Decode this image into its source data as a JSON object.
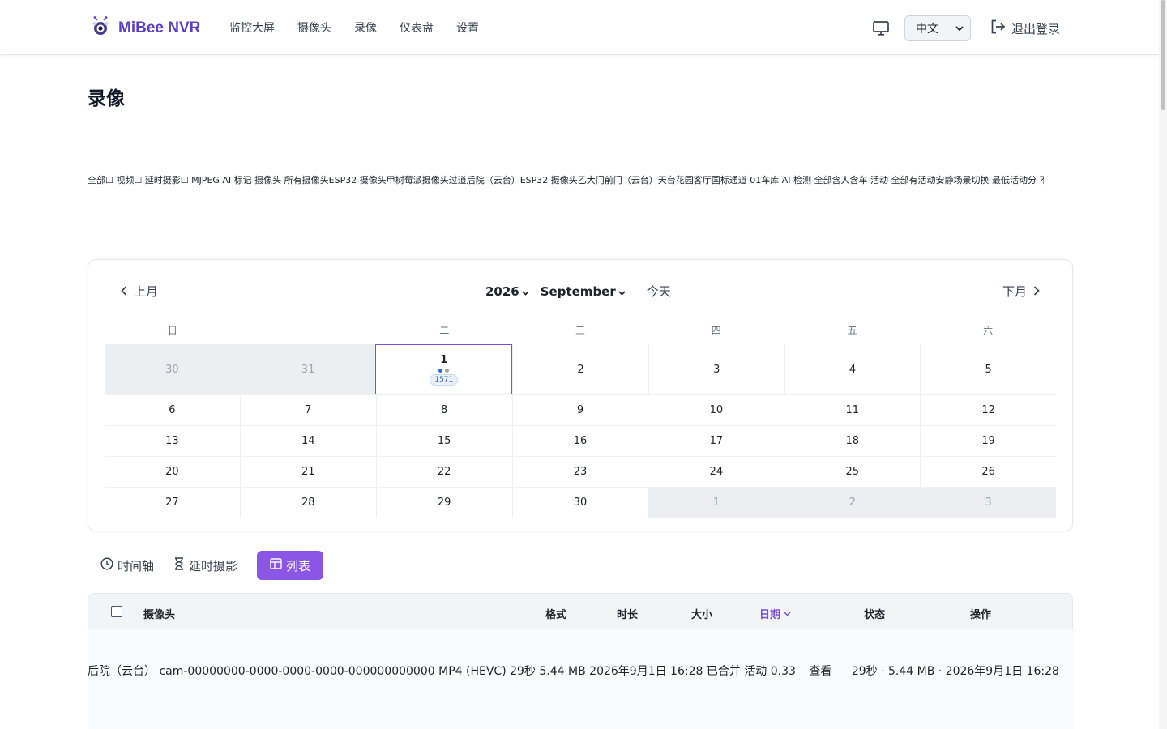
{
  "header": {
    "brand": "MiBee NVR",
    "nav": [
      "监控大屏",
      "摄像头",
      "录像",
      "仪表盘",
      "设置"
    ],
    "language": "中文",
    "logout": "退出登录"
  },
  "page": {
    "title": "录像",
    "filters_text": "全部☐ 视频☐ 延时摄影☐ MJPEG  AI 标记 摄像头 所有摄像头ESP32 摄像头甲树莓派摄像头过道后院（云台）ESP32 摄像头乙大门前门（云台）天台花园客厅国标通道 01车库 AI 检测 全部含人含车 活动 全部有活动安静场景切换 最低活动分 不"
  },
  "calendar": {
    "prev_label": "上月",
    "next_label": "下月",
    "year": "2026",
    "month": "September",
    "today_label": "今天",
    "weekdays": [
      "日",
      "一",
      "二",
      "三",
      "四",
      "五",
      "六"
    ],
    "weeks": [
      [
        "30",
        "31",
        "1",
        "2",
        "3",
        "4",
        "5"
      ],
      [
        "6",
        "7",
        "8",
        "9",
        "10",
        "11",
        "12"
      ],
      [
        "13",
        "14",
        "15",
        "16",
        "17",
        "18",
        "19"
      ],
      [
        "20",
        "21",
        "22",
        "23",
        "24",
        "25",
        "26"
      ],
      [
        "27",
        "28",
        "29",
        "30",
        "1",
        "2",
        "3"
      ]
    ],
    "selected_day_count": "1571",
    "colors": {
      "dot_primary": "#2f66c8",
      "dot_secondary": "#9ca3af",
      "accent": "#7c4ddb"
    }
  },
  "view_tabs": [
    {
      "label": "时间轴",
      "icon": "clock-icon"
    },
    {
      "label": "延时摄影",
      "icon": "hourglass-icon"
    },
    {
      "label": "列表",
      "icon": "table-icon",
      "active": true
    }
  ],
  "table": {
    "columns": {
      "camera": "摄像头",
      "format": "格式",
      "duration": "时长",
      "size": "大小",
      "date": "日期",
      "status": "状态",
      "actions": "操作"
    },
    "rows": [
      {
        "camera": "后院（云台）",
        "id": "cam-00000000-0000-0000-0000-000000000000",
        "format": "MP4 (HEVC)",
        "duration": "29秒",
        "size": "5.44 MB",
        "date": "2026年9月1日 16:28",
        "status": "已合并",
        "activity": "活动 0.33",
        "action": "查看",
        "summary": "29秒 · 5.44 MB · 2026年9月1日 16:28"
      }
    ]
  }
}
